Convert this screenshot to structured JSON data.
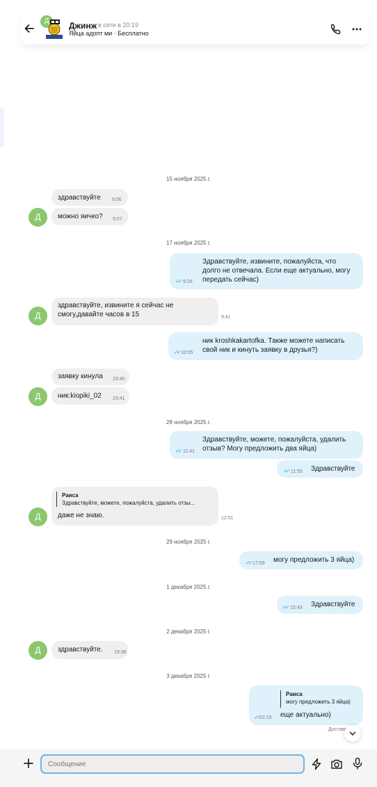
{
  "header": {
    "avatar_letter": "Д",
    "name": "Джинж",
    "status": "в сети в 20:19",
    "subtitle": "Яйца адопт ми · Бесплатно"
  },
  "icons": {
    "back": "arrow-left-icon",
    "call": "phone-icon",
    "more": "more-horizontal-icon",
    "read": "double-check-icon",
    "scroll": "chevron-down-icon",
    "attach": "plus-icon",
    "quick": "lightning-icon",
    "camera": "camera-icon",
    "mic": "microphone-icon"
  },
  "colors": {
    "incoming_bubble": "#f0efed",
    "outgoing_bubble": "#dff1fb",
    "avatar": "#8bc76d",
    "read_check": "#2f9be0",
    "input_border": "#6cb6e8"
  },
  "dates": [
    "15 ноября 2025 г.",
    "17 ноября 2025 г.",
    "28 ноября 2025 г.",
    "29 ноября 2025 г.",
    "1 декабря 2025 г.",
    "2 декабря 2025 г.",
    "3 декабря 2025 г."
  ],
  "avatar_letter": "Д",
  "messages": [
    {
      "text": "здравствуйте",
      "time": "9:06"
    },
    {
      "text": "можно яичко?",
      "time": "9:07"
    },
    {
      "lines": [
        "Здравствуйте, извините, пожалуйста, что",
        "долго не отвечала. Если еще актуально, могу",
        "передать сейчас)"
      ],
      "time": "9:26"
    },
    {
      "lines": [
        "здравствуйте, извините я сейчас не",
        "смогу,давайте часов в 15"
      ],
      "time": "9:41"
    },
    {
      "lines": [
        "ник kroshkakartofka. Также можете написать",
        "свой ник и кинуть заявку в друзья?)"
      ],
      "time": "10:55"
    },
    {
      "text": "заявку кинула",
      "time": "23:40"
    },
    {
      "text": "ник:kiopiki_02",
      "time": "23:41"
    },
    {
      "lines": [
        "Здравствуйте, можете, пожалуйста, удалить",
        "отзыв? Могу предложить два яйца)"
      ],
      "time": "11:41"
    },
    {
      "text": "Здравствуйте",
      "time": "11:55"
    },
    {
      "quote_author": "Раиса",
      "quote_text": "Здравствуйте, можете, пожалуйста, удалить отзы...",
      "text": "даже не знаю.",
      "time": "12:51"
    },
    {
      "text": "могу предложить 3 яйца)",
      "time": "17:59"
    },
    {
      "text": "Здравствуйте",
      "time": "15:43"
    },
    {
      "text": "здравствуйте.",
      "time": "19:38"
    },
    {
      "quote_author": "Раиса",
      "quote_text": "могу предложить 3 яйца)",
      "text": "еще актуально)",
      "time": "22:19"
    }
  ],
  "delivered_label": "Доставл",
  "composer": {
    "placeholder": "Сообщение"
  }
}
